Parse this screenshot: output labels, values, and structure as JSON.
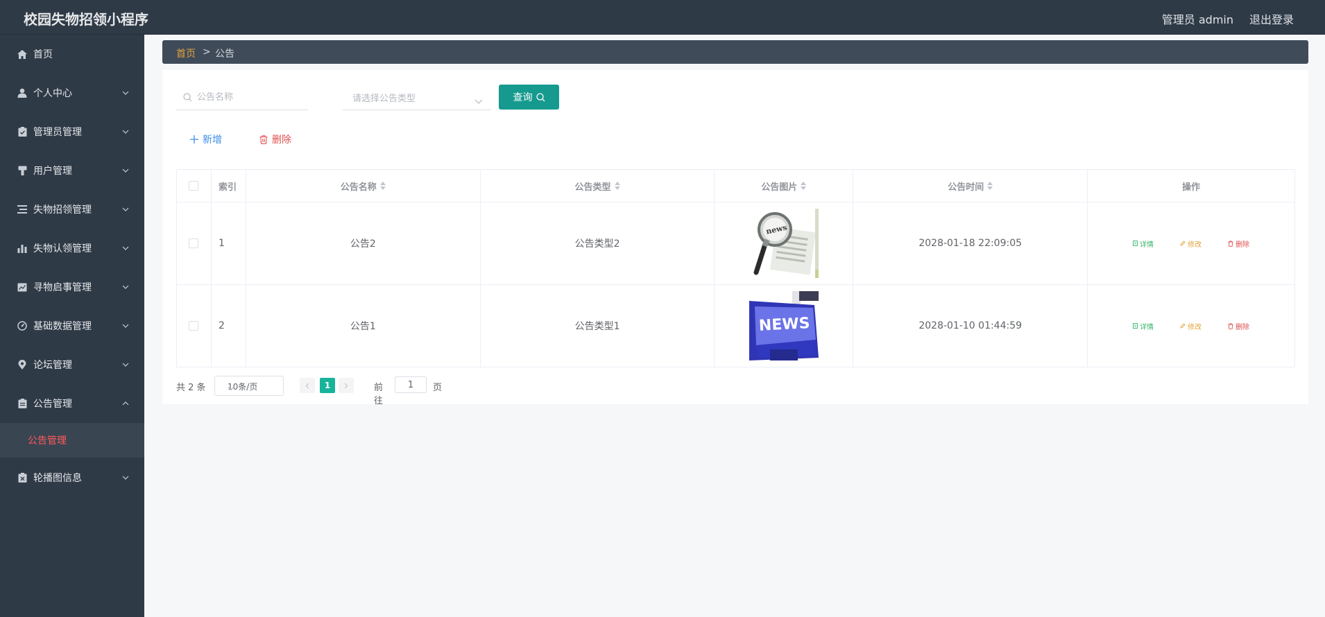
{
  "app": {
    "title": "校园失物招领小程序"
  },
  "header": {
    "user": "管理员 admin",
    "logout": "退出登录"
  },
  "sidebar": {
    "items": [
      {
        "label": "首页",
        "icon": "home-icon",
        "chevron": false
      },
      {
        "label": "个人中心",
        "icon": "user-icon",
        "chevron": true
      },
      {
        "label": "管理员管理",
        "icon": "clipboard-check-icon",
        "chevron": true
      },
      {
        "label": "用户管理",
        "icon": "stamp-icon",
        "chevron": true
      },
      {
        "label": "失物招领管理",
        "icon": "list-icon",
        "chevron": true
      },
      {
        "label": "失物认领管理",
        "icon": "bar-chart-icon",
        "chevron": true
      },
      {
        "label": "寻物启事管理",
        "icon": "line-chart-icon",
        "chevron": true
      },
      {
        "label": "基础数据管理",
        "icon": "gauge-icon",
        "chevron": true
      },
      {
        "label": "论坛管理",
        "icon": "location-icon",
        "chevron": true
      },
      {
        "label": "公告管理",
        "icon": "clipboard-icon",
        "chevron": true,
        "expanded": true
      },
      {
        "label": "轮播图信息",
        "icon": "clipboard-x-icon",
        "chevron": true
      }
    ],
    "sub_item": "公告管理"
  },
  "breadcrumb": {
    "home": "首页",
    "separator": ">",
    "current": "公告"
  },
  "search": {
    "name_placeholder": "公告名称",
    "type_placeholder": "请选择公告类型",
    "query_label": "查询"
  },
  "actions": {
    "add_label": "新增",
    "delete_label": "删除"
  },
  "table": {
    "headers": {
      "index": "索引",
      "name": "公告名称",
      "type": "公告类型",
      "image": "公告图片",
      "time": "公告时间",
      "operation": "操作"
    },
    "rows": [
      {
        "index": "1",
        "name": "公告2",
        "type": "公告类型2",
        "image": "magnifier-newspaper",
        "time": "2028-01-18 22:09:05"
      },
      {
        "index": "2",
        "name": "公告1",
        "type": "公告类型1",
        "image": "news-key",
        "time": "2028-01-10 01:44:59"
      }
    ],
    "ops": {
      "detail": "详情",
      "edit": "修改",
      "delete": "删除"
    }
  },
  "pager": {
    "total": "共 2 条",
    "page_size": "10条/页",
    "current_page": "1",
    "goto": "前往",
    "goto_value": "1",
    "unit": "页"
  },
  "colors": {
    "sidebar_bg": "#2f3a47",
    "accent": "#169a8f",
    "page_active": "#17b39b",
    "active_submenu": "#ff5a5a"
  }
}
